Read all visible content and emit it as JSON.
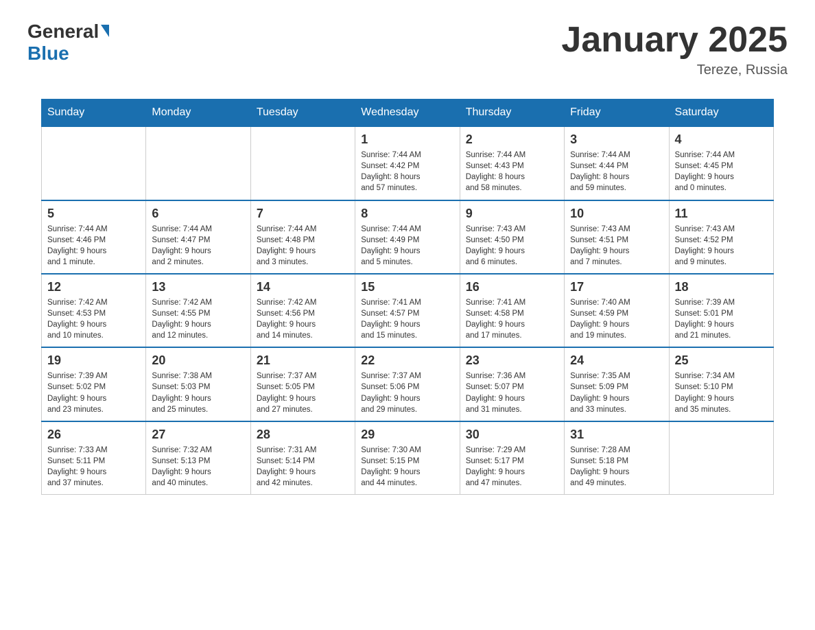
{
  "logo": {
    "general": "General",
    "triangle": "▶",
    "blue": "Blue"
  },
  "title": "January 2025",
  "location": "Tereze, Russia",
  "days_of_week": [
    "Sunday",
    "Monday",
    "Tuesday",
    "Wednesday",
    "Thursday",
    "Friday",
    "Saturday"
  ],
  "weeks": [
    {
      "days": [
        {
          "number": "",
          "info": ""
        },
        {
          "number": "",
          "info": ""
        },
        {
          "number": "",
          "info": ""
        },
        {
          "number": "1",
          "info": "Sunrise: 7:44 AM\nSunset: 4:42 PM\nDaylight: 8 hours\nand 57 minutes."
        },
        {
          "number": "2",
          "info": "Sunrise: 7:44 AM\nSunset: 4:43 PM\nDaylight: 8 hours\nand 58 minutes."
        },
        {
          "number": "3",
          "info": "Sunrise: 7:44 AM\nSunset: 4:44 PM\nDaylight: 8 hours\nand 59 minutes."
        },
        {
          "number": "4",
          "info": "Sunrise: 7:44 AM\nSunset: 4:45 PM\nDaylight: 9 hours\nand 0 minutes."
        }
      ]
    },
    {
      "days": [
        {
          "number": "5",
          "info": "Sunrise: 7:44 AM\nSunset: 4:46 PM\nDaylight: 9 hours\nand 1 minute."
        },
        {
          "number": "6",
          "info": "Sunrise: 7:44 AM\nSunset: 4:47 PM\nDaylight: 9 hours\nand 2 minutes."
        },
        {
          "number": "7",
          "info": "Sunrise: 7:44 AM\nSunset: 4:48 PM\nDaylight: 9 hours\nand 3 minutes."
        },
        {
          "number": "8",
          "info": "Sunrise: 7:44 AM\nSunset: 4:49 PM\nDaylight: 9 hours\nand 5 minutes."
        },
        {
          "number": "9",
          "info": "Sunrise: 7:43 AM\nSunset: 4:50 PM\nDaylight: 9 hours\nand 6 minutes."
        },
        {
          "number": "10",
          "info": "Sunrise: 7:43 AM\nSunset: 4:51 PM\nDaylight: 9 hours\nand 7 minutes."
        },
        {
          "number": "11",
          "info": "Sunrise: 7:43 AM\nSunset: 4:52 PM\nDaylight: 9 hours\nand 9 minutes."
        }
      ]
    },
    {
      "days": [
        {
          "number": "12",
          "info": "Sunrise: 7:42 AM\nSunset: 4:53 PM\nDaylight: 9 hours\nand 10 minutes."
        },
        {
          "number": "13",
          "info": "Sunrise: 7:42 AM\nSunset: 4:55 PM\nDaylight: 9 hours\nand 12 minutes."
        },
        {
          "number": "14",
          "info": "Sunrise: 7:42 AM\nSunset: 4:56 PM\nDaylight: 9 hours\nand 14 minutes."
        },
        {
          "number": "15",
          "info": "Sunrise: 7:41 AM\nSunset: 4:57 PM\nDaylight: 9 hours\nand 15 minutes."
        },
        {
          "number": "16",
          "info": "Sunrise: 7:41 AM\nSunset: 4:58 PM\nDaylight: 9 hours\nand 17 minutes."
        },
        {
          "number": "17",
          "info": "Sunrise: 7:40 AM\nSunset: 4:59 PM\nDaylight: 9 hours\nand 19 minutes."
        },
        {
          "number": "18",
          "info": "Sunrise: 7:39 AM\nSunset: 5:01 PM\nDaylight: 9 hours\nand 21 minutes."
        }
      ]
    },
    {
      "days": [
        {
          "number": "19",
          "info": "Sunrise: 7:39 AM\nSunset: 5:02 PM\nDaylight: 9 hours\nand 23 minutes."
        },
        {
          "number": "20",
          "info": "Sunrise: 7:38 AM\nSunset: 5:03 PM\nDaylight: 9 hours\nand 25 minutes."
        },
        {
          "number": "21",
          "info": "Sunrise: 7:37 AM\nSunset: 5:05 PM\nDaylight: 9 hours\nand 27 minutes."
        },
        {
          "number": "22",
          "info": "Sunrise: 7:37 AM\nSunset: 5:06 PM\nDaylight: 9 hours\nand 29 minutes."
        },
        {
          "number": "23",
          "info": "Sunrise: 7:36 AM\nSunset: 5:07 PM\nDaylight: 9 hours\nand 31 minutes."
        },
        {
          "number": "24",
          "info": "Sunrise: 7:35 AM\nSunset: 5:09 PM\nDaylight: 9 hours\nand 33 minutes."
        },
        {
          "number": "25",
          "info": "Sunrise: 7:34 AM\nSunset: 5:10 PM\nDaylight: 9 hours\nand 35 minutes."
        }
      ]
    },
    {
      "days": [
        {
          "number": "26",
          "info": "Sunrise: 7:33 AM\nSunset: 5:11 PM\nDaylight: 9 hours\nand 37 minutes."
        },
        {
          "number": "27",
          "info": "Sunrise: 7:32 AM\nSunset: 5:13 PM\nDaylight: 9 hours\nand 40 minutes."
        },
        {
          "number": "28",
          "info": "Sunrise: 7:31 AM\nSunset: 5:14 PM\nDaylight: 9 hours\nand 42 minutes."
        },
        {
          "number": "29",
          "info": "Sunrise: 7:30 AM\nSunset: 5:15 PM\nDaylight: 9 hours\nand 44 minutes."
        },
        {
          "number": "30",
          "info": "Sunrise: 7:29 AM\nSunset: 5:17 PM\nDaylight: 9 hours\nand 47 minutes."
        },
        {
          "number": "31",
          "info": "Sunrise: 7:28 AM\nSunset: 5:18 PM\nDaylight: 9 hours\nand 49 minutes."
        },
        {
          "number": "",
          "info": ""
        }
      ]
    }
  ]
}
